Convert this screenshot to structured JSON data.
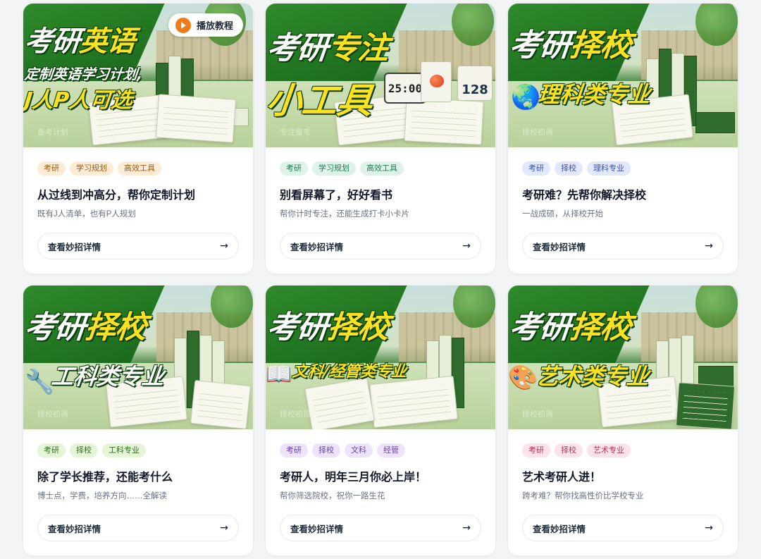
{
  "cards": [
    {
      "banner": {
        "headline_white": "考研",
        "headline_yellow": "英语",
        "sub1": "定制英语学习计划,",
        "sub2": "J人P人可选",
        "watermark": "备考计划",
        "play_button": "播放教程"
      },
      "tags": [
        {
          "label": "考研",
          "color": "orange"
        },
        {
          "label": "学习规划",
          "color": "orange"
        },
        {
          "label": "高效工具",
          "color": "orange"
        }
      ],
      "title": "从过线到冲高分，帮你定制计划",
      "desc": "既有J人清单，也有P人规划",
      "cta": "查看妙招详情"
    },
    {
      "banner": {
        "headline_white": "考研",
        "headline_yellow": "专注",
        "sub1": "小工具",
        "watermark": "专注备考",
        "timer": "25:00",
        "counter": "128"
      },
      "tags": [
        {
          "label": "考研",
          "color": "teal"
        },
        {
          "label": "学习规划",
          "color": "teal"
        },
        {
          "label": "高效工具",
          "color": "teal"
        }
      ],
      "title": "别看屏幕了，好好看书",
      "desc": "帮你计时专注，还能生成打卡小卡片",
      "cta": "查看妙招详情"
    },
    {
      "banner": {
        "headline_white": "考研",
        "headline_yellow": "择校",
        "sub1": "理科类专业",
        "watermark": "择校初筛",
        "icon": "globe-icon"
      },
      "tags": [
        {
          "label": "考研",
          "color": "blue"
        },
        {
          "label": "择校",
          "color": "blue"
        },
        {
          "label": "理科专业",
          "color": "blue"
        }
      ],
      "title": "考研难？先帮你解决择校",
      "desc": "一战成硕，从择校开始",
      "cta": "查看妙招详情"
    },
    {
      "banner": {
        "headline_white": "考研",
        "headline_yellow": "择校",
        "sub1": "工科类专业",
        "watermark": "择校初筛",
        "icon": "wrench-icon"
      },
      "tags": [
        {
          "label": "考研",
          "color": "lime"
        },
        {
          "label": "择校",
          "color": "lime"
        },
        {
          "label": "工科专业",
          "color": "lime"
        }
      ],
      "title": "除了学长推荐，还能考什么",
      "desc": "博士点，学费，培养方向……全解读",
      "cta": "查看妙招详情"
    },
    {
      "banner": {
        "headline_white": "考研",
        "headline_yellow": "择校",
        "sub1": "文科/经管类专业",
        "watermark": "择校初筛",
        "icon": "book-icon"
      },
      "tags": [
        {
          "label": "考研",
          "color": "purple"
        },
        {
          "label": "择校",
          "color": "purple"
        },
        {
          "label": "文科",
          "color": "purple"
        },
        {
          "label": "经管",
          "color": "purple"
        }
      ],
      "title": "考研人，明年三月你必上岸！",
      "desc": "帮你筛选院校，祝你一路生花",
      "cta": "查看妙招详情"
    },
    {
      "banner": {
        "headline_white": "考研",
        "headline_yellow": "择校",
        "sub1": "艺术类专业",
        "watermark": "择校初筛",
        "icon": "palette-icon"
      },
      "tags": [
        {
          "label": "考研",
          "color": "pink"
        },
        {
          "label": "择校",
          "color": "pink"
        },
        {
          "label": "艺术专业",
          "color": "pink"
        }
      ],
      "title": "艺术考研人进！",
      "desc": "跨考难？帮你找高性价比学校专业",
      "cta": "查看妙招详情"
    }
  ]
}
